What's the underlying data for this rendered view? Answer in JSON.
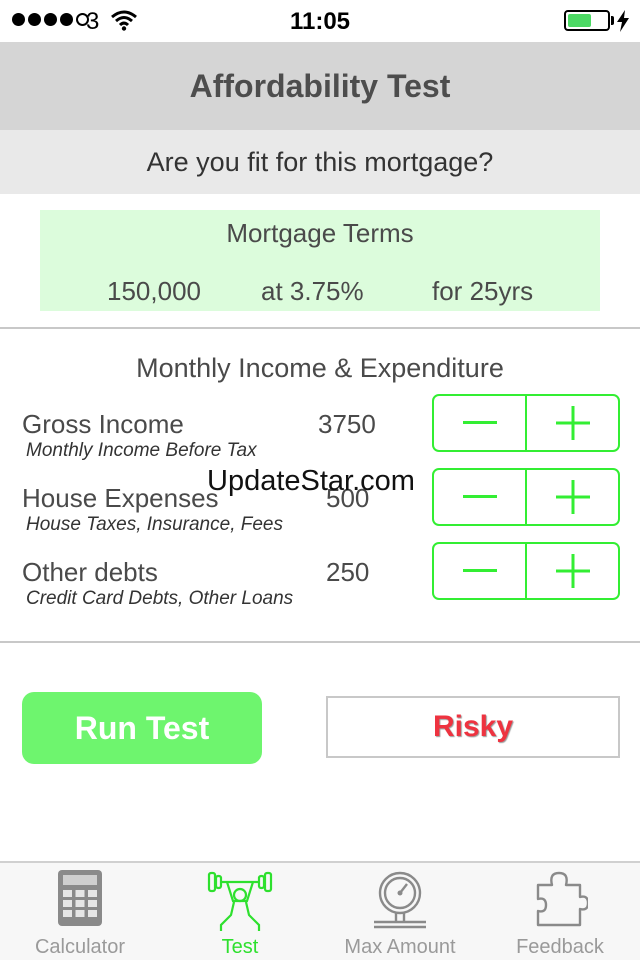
{
  "status_bar": {
    "carrier": "3",
    "time": "11:05",
    "battery_level": 0.6,
    "signal_bars_filled": 4,
    "signal_bars_total": 5
  },
  "nav": {
    "title": "Affordability Test",
    "subtitle": "Are you fit for this mortgage?"
  },
  "mortgage_terms": {
    "title": "Mortgage Terms",
    "amount": "150,000",
    "rate": "at 3.75%",
    "term": "for 25yrs"
  },
  "income": {
    "section_title": "Monthly Income & Expenditure",
    "rows": [
      {
        "label": "Gross Income",
        "sublabel": "Monthly Income Before Tax",
        "value": "3750"
      },
      {
        "label": "House Expenses",
        "sublabel": "House Taxes, Insurance, Fees",
        "value": "500"
      },
      {
        "label": "Other debts",
        "sublabel": "Credit Card Debts, Other Loans",
        "value": "250"
      }
    ]
  },
  "watermark": "UpdateStar.com",
  "actions": {
    "run_label": "Run Test",
    "result_label": "Risky"
  },
  "tabs": [
    {
      "label": "Calculator",
      "icon": "calculator-icon",
      "active": false
    },
    {
      "label": "Test",
      "icon": "weightlifter-icon",
      "active": true
    },
    {
      "label": "Max Amount",
      "icon": "gauge-icon",
      "active": false
    },
    {
      "label": "Feedback",
      "icon": "puzzle-icon",
      "active": false
    }
  ],
  "colors": {
    "accent_green": "#33ee33",
    "run_button": "#6ef56e",
    "terms_background": "#dcfcdc",
    "risky_red": "#ee3340",
    "nav_background": "#d5d5d5"
  }
}
